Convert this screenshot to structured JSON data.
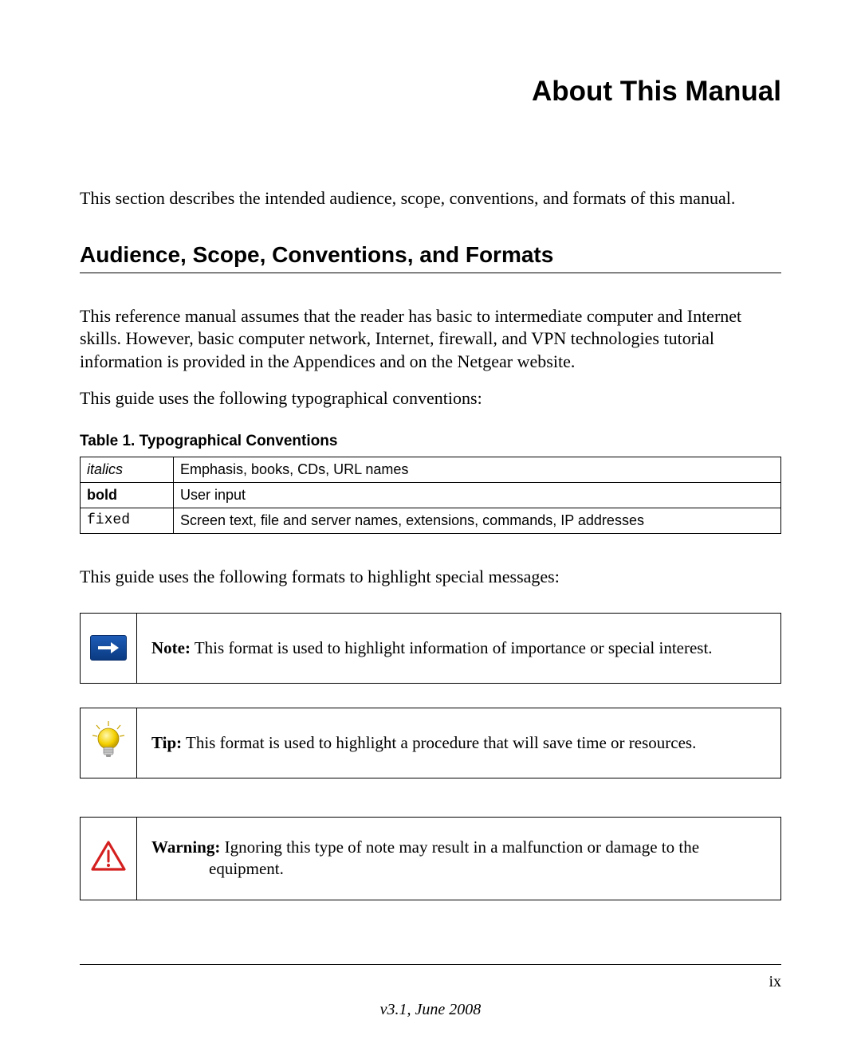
{
  "chapter_title": "About This Manual",
  "intro": "This section describes the intended audience, scope, conventions, and formats of this manual.",
  "section_heading": "Audience, Scope, Conventions, and Formats",
  "para1": "This reference manual assumes that the reader has basic to intermediate computer and Internet skills. However, basic computer network, Internet, firewall, and VPN technologies tutorial information is provided in the Appendices and on the Netgear website.",
  "para2": "This guide uses the following typographical conventions:",
  "table_caption": "Table  1. Typographical Conventions",
  "conventions": {
    "row1": {
      "label": "italics",
      "desc": "Emphasis, books, CDs, URL names"
    },
    "row2": {
      "label": "bold",
      "desc": "User input"
    },
    "row3": {
      "label": "fixed",
      "desc": "Screen text, file and server names, extensions, commands, IP addresses"
    }
  },
  "para3": "This guide uses the following formats to highlight special messages:",
  "note": {
    "label": "Note:",
    "text": " This format is used to highlight information of importance or special interest."
  },
  "tip": {
    "label": "Tip:",
    "text": " This format is used to highlight a procedure that will save time or resources."
  },
  "warning": {
    "label": "Warning:",
    "text": " Ignoring this type of note may result in a malfunction or damage to the ",
    "text2": "equipment."
  },
  "page_number": "ix",
  "version": "v3.1, June 2008"
}
